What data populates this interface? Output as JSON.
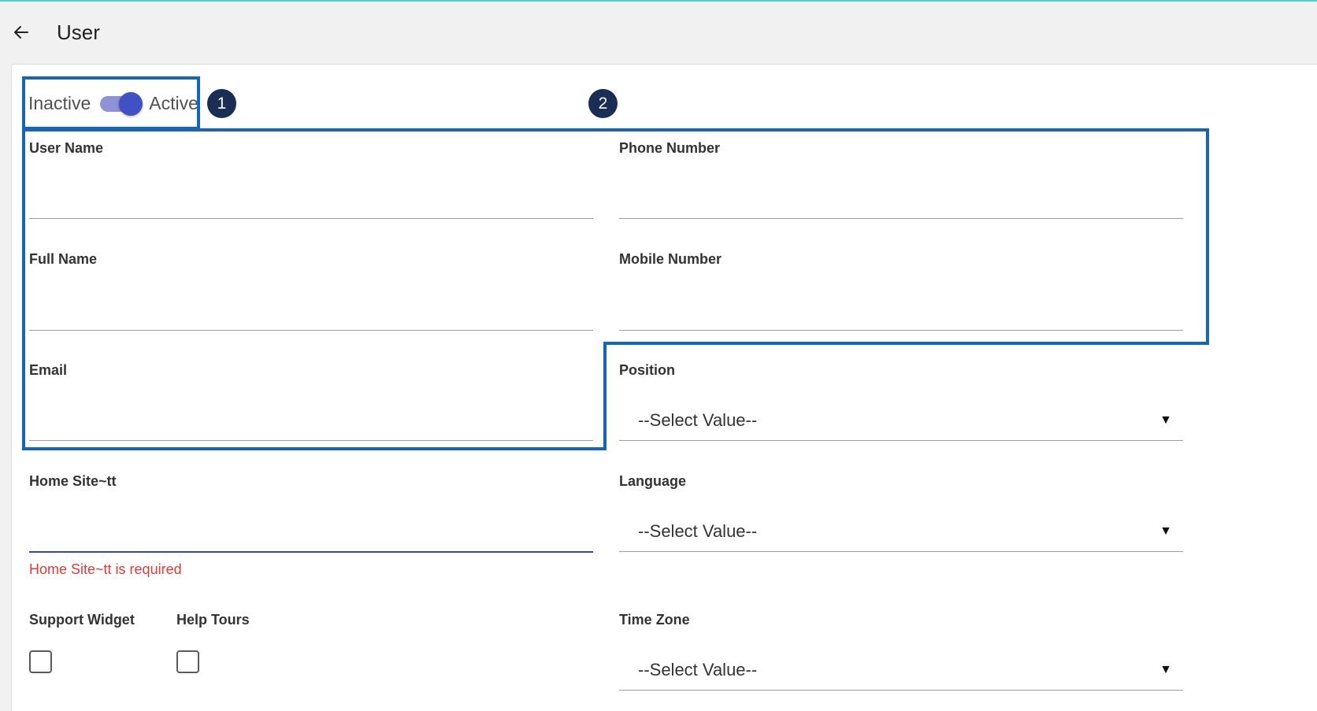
{
  "header": {
    "title": "User"
  },
  "status_toggle": {
    "inactive_label": "Inactive",
    "active_label": "Active",
    "state": "Active"
  },
  "markers": [
    "1",
    "2"
  ],
  "fields": {
    "user_name": {
      "label": "User Name",
      "value": ""
    },
    "phone_number": {
      "label": "Phone Number",
      "value": ""
    },
    "full_name": {
      "label": "Full Name",
      "value": ""
    },
    "mobile_number": {
      "label": "Mobile Number",
      "value": ""
    },
    "email": {
      "label": "Email",
      "value": ""
    },
    "position": {
      "label": "Position",
      "value": "--Select Value--"
    },
    "home_site": {
      "label": "Home Site~tt",
      "value": "",
      "error": "Home Site~tt is required"
    },
    "language": {
      "label": "Language",
      "value": "--Select Value--"
    },
    "support_widget": {
      "label": "Support Widget",
      "checked": false
    },
    "help_tours": {
      "label": "Help Tours",
      "checked": false
    },
    "time_zone": {
      "label": "Time Zone",
      "value": "--Select Value--"
    }
  },
  "icons": {
    "back": "arrow-left-icon",
    "dropdown": "caret-down-icon"
  },
  "colors": {
    "accent": "#3f51c4",
    "error": "#e53935",
    "highlight": "#1565b8",
    "marker": "#1a2e55",
    "top_accent": "#4dd0c6"
  }
}
